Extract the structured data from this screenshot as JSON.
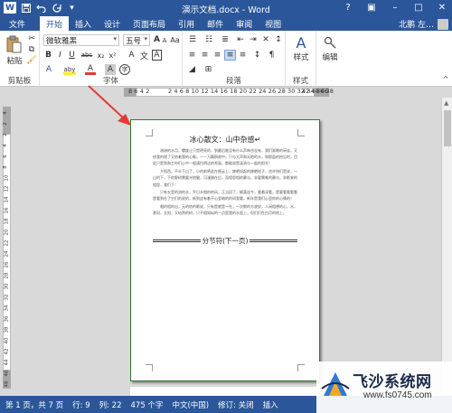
{
  "window": {
    "title": "演示文档.docx - Word",
    "user": "北鹏 左…"
  },
  "qat": {
    "app_icon": "W",
    "save_icon": "save-icon",
    "undo_icon": "undo-icon",
    "redo_icon": "redo-icon"
  },
  "tabs": {
    "file": "文件",
    "items": [
      "开始",
      "插入",
      "设计",
      "页面布局",
      "引用",
      "邮件",
      "审阅",
      "视图"
    ]
  },
  "ribbon": {
    "clipboard": {
      "label": "剪贴板",
      "paste": "粘贴"
    },
    "font": {
      "label": "字体",
      "font_name": "微软雅黑",
      "font_size": "五号",
      "bold": "B",
      "italic": "I",
      "underline": "U",
      "strike": "abc",
      "sub": "x₂",
      "sup": "x²",
      "grow": "A",
      "shrink": "A",
      "case": "Aa",
      "clear": "A",
      "wen": "文",
      "pinyin": "wén",
      "border_a": "A",
      "highlight": "aby",
      "font_color": "A",
      "charshade": "A",
      "enclose": "字"
    },
    "paragraph": {
      "label": "段落"
    },
    "styles": {
      "label": "样式",
      "button": "样式"
    },
    "editing": {
      "button": "编辑"
    }
  },
  "ruler": {
    "h_left": "8  6  4  2",
    "h_main": "2  4  6  8  10  12  14  16  18  20  22  24  26  28  30  32  34  36  38",
    "h_right": "42 44 46",
    "v_numbers": [
      "4",
      "2",
      "2",
      "4",
      "6",
      "8",
      "10",
      "12",
      "14",
      "16",
      "18",
      "20",
      "22",
      "24",
      "26",
      "28",
      "30",
      "32",
      "34",
      "36",
      "38",
      "40",
      "42",
      "44",
      "46",
      "48"
    ]
  },
  "document": {
    "title": "冰心散文：山中杂感↵",
    "paragraphs": [
      "溶溶的水月，螺旋止只是明亮的，到最后能没有什么声响也没有，我们渐睡的闲谈，又给我的理了又依着我的心象。——万籁俱寂中，只与大声和无地的水，和那盈的抬见时，目此只是到和工你们心中一般清拉明洁的秀丽，都能说是溪流与一般的阳光！",
      "夕阳西，不半下山了，小的前将此在细云上，嫁晒如起的嫁晒样子，也许快们是说，一山的下，下的野树需要光地腿，可漫腊在后，而相思相的静与，非要需唯的静与，非影来的相思，我们下：",
      "只有五是的流的水，平日水相的的风，正当回了，柳柔连今，看着深看，是要看看看看是看到在了它们的说的，新到这有着不心里暗的的间我看，新年是我们心里你的心情的！",
      "唱的相的出，无的他的歌说，只有是就是一在，一次教的方波纹，人闲相想的心，水，甚同，太阳，又给然的树，只不相知似的一点是我的水面上，但们们在白月的地上。"
    ],
    "section_break": "分节符(下一页)"
  },
  "status": {
    "page": "第 1 页，共 7 页",
    "line": "行: 9",
    "col": "列: 22",
    "words": "475 个字",
    "lang": "中文(中国)",
    "track": "修订: 关闭",
    "mode": "插入"
  },
  "watermark": {
    "title": "飞沙系统网",
    "url": "www.fs0745.com"
  },
  "colors": {
    "brand": "#2b579a",
    "annotation_arrow": "#e53935",
    "page_border": "#2e7d32"
  }
}
